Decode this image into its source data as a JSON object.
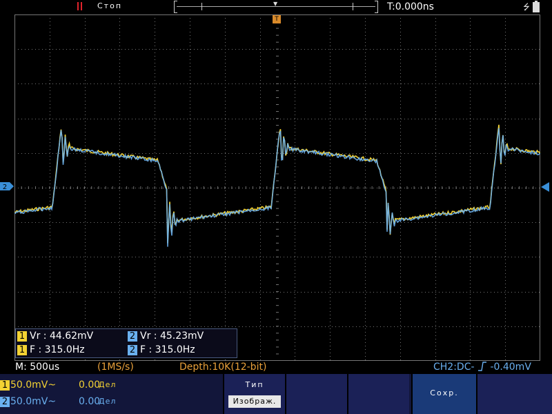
{
  "topbar": {
    "status": "Стоп",
    "trigger_time": "T:0.000ns",
    "usb_icon": "usb-icon",
    "battery_icon": "battery-icon"
  },
  "markers": {
    "trigger_position": "T",
    "channel2_ground": "2"
  },
  "measurements": {
    "ch1_vr": "Vr : 44.62mV",
    "ch2_vr": "Vr : 45.23mV",
    "ch1_freq": "F : 315.0Hz",
    "ch2_freq": "F : 315.0Hz"
  },
  "info": {
    "timebase": "M: 500us",
    "sample_rate": "(1MS/s)",
    "depth": "Depth:10K(12-bit)",
    "trigger": "CH2:DC-",
    "trigger_level": "-0.40mV"
  },
  "channels": [
    {
      "badge": "1",
      "scale": "50.0mV~",
      "offset": "0.00",
      "unit": "Дел"
    },
    {
      "badge": "2",
      "scale": "50.0mV~",
      "offset": "0.00",
      "unit": "Дел"
    }
  ],
  "softkeys": {
    "type_title": "Тип",
    "type_value": "Изображ.",
    "save_title": "Сохр."
  },
  "colors": {
    "ch1": "#f3d233",
    "ch2": "#6ab0f0",
    "grid": "#777777",
    "trigger": "#d98a2a"
  }
}
